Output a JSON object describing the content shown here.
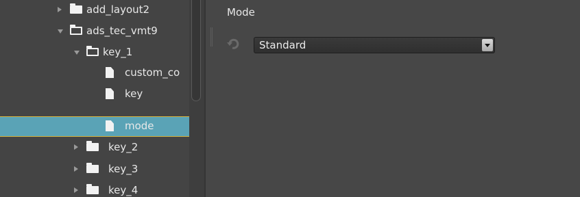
{
  "tree": {
    "items": [
      {
        "label": "add_layout2",
        "type": "folder",
        "expanded": false,
        "selected": false
      },
      {
        "label": "ads_tec_vmt9",
        "type": "folder",
        "expanded": true,
        "selected": false
      },
      {
        "label": "key_1",
        "type": "folder",
        "expanded": true,
        "selected": false
      },
      {
        "label": "custom_co",
        "type": "file",
        "selected": false
      },
      {
        "label": "key",
        "type": "file",
        "selected": false
      },
      {
        "label": "mode",
        "type": "file",
        "selected": true
      },
      {
        "label": "key_2",
        "type": "folder",
        "expanded": false,
        "selected": false
      },
      {
        "label": "key_3",
        "type": "folder",
        "expanded": false,
        "selected": false
      },
      {
        "label": "key_4",
        "type": "folder",
        "expanded": false,
        "selected": false
      }
    ]
  },
  "property": {
    "title": "Mode",
    "value": "Standard",
    "reset_icon": "reset-icon"
  },
  "colors": {
    "background": "#474747",
    "selection": "#5aa3b6",
    "selection_border": "#d8b23a"
  }
}
